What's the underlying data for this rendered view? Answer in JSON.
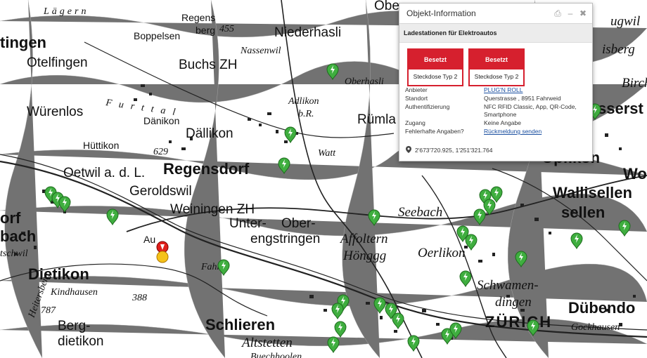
{
  "popup": {
    "title": "Objekt-Information",
    "print_icon": "printer-icon",
    "minimize_icon": "minimize-icon",
    "close_icon": "close-icon",
    "layer_name": "Ladestationen für Elektroautos",
    "status_boxes": [
      {
        "status": "Besetzt",
        "type": "Steckdose Typ 2"
      },
      {
        "status": "Besetzt",
        "type": "Steckdose Typ 2"
      }
    ],
    "fields": {
      "anbieter_label": "Anbieter",
      "anbieter_value": "PLUG'N ROLL",
      "standort_label": "Standort",
      "standort_value": "Querstrasse , 8951 Fahrweid",
      "auth_label": "Authentifizierung",
      "auth_value": "NFC RFID Classic, App, QR-Code, Smartphone",
      "zugang_label": "Zugang",
      "zugang_value": "Keine Angabe",
      "fehler_label": "Fehlerhafte Angaben?",
      "fehler_value": "Rückmeldung senden"
    },
    "coordinates": "2'673'720.925, 1'251'321.764",
    "location_icon": "map-marker-icon",
    "accent_color": "#d6202e"
  },
  "map": {
    "marker_color": "#3fae3f",
    "selected_marker_colors": [
      "#e0201c",
      "#f5c21a"
    ],
    "labels": [
      "Obe",
      "Regens",
      "berg",
      "455",
      "Boppelsen",
      "Niederhasli",
      "Nassenwil",
      "Lägern",
      "tingen",
      "Otelfingen",
      "Buchs ZH",
      "Oberhasli",
      "Adlikon",
      "b.R.",
      "Würenlos",
      "Furttal",
      "Dänikon",
      "Dällikon",
      "Rümla",
      "Hüttikon",
      "629",
      "Watt",
      "Oetwil a. d. L.",
      "Regensdorf",
      "Geroldswil",
      "Weiningen ZH",
      "Unter-",
      "Ober-",
      "engstringen",
      "Seebach",
      "Affoltern",
      "Hönggg",
      "Oerlikon",
      "Wallisellen",
      "sellen",
      "Wolli",
      "orf",
      "bach",
      "tschwil",
      "Dietikon",
      "Kindhausen",
      "787",
      "Berg-",
      "dietikon",
      "Heitersberg",
      "388",
      "Au",
      "Fahr",
      "Schlieren",
      "Altstetten",
      "Buechhoolen",
      "Schwamen-",
      "dingen",
      "ZÜRICH",
      "Dübendo",
      "Gockhausen",
      "Opfikon",
      "Birch",
      "sserst",
      "isberg",
      "ugwil"
    ]
  }
}
